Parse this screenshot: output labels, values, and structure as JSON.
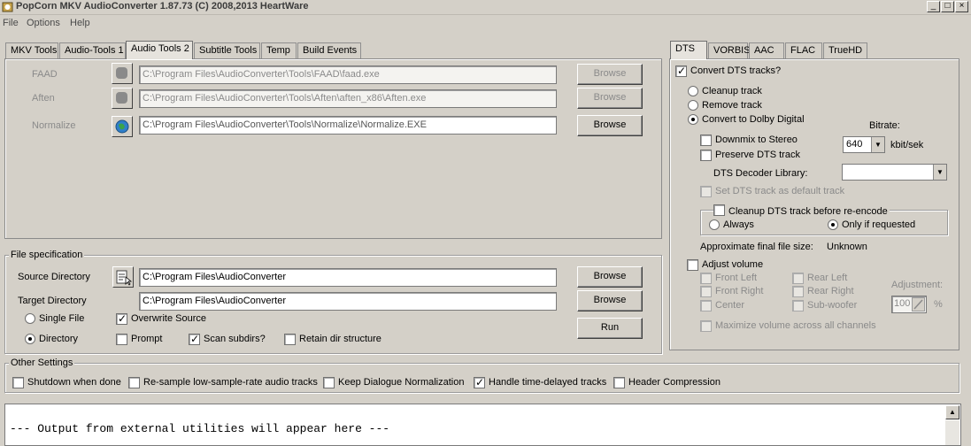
{
  "window": {
    "title": "PopCorn MKV AudioConverter 1.87.73 (C) 2008,2013 HeartWare",
    "minimize": "_",
    "maximize": "□",
    "close": "×"
  },
  "menu": [
    "File",
    "Options",
    "Help"
  ],
  "left_tabs": [
    "MKV Tools",
    "Audio-Tools 1",
    "Audio Tools 2",
    "Subtitle Tools",
    "Temp",
    "Build Events"
  ],
  "tools": [
    {
      "label": "FAAD",
      "path": "C:\\Program Files\\AudioConverter\\Tools\\FAAD\\faad.exe",
      "button": "Browse",
      "enabled": false,
      "icon": "stop-icon"
    },
    {
      "label": "Aften",
      "path": "C:\\Program Files\\AudioConverter\\Tools\\Aften\\aften_x86\\Aften.exe",
      "button": "Browse",
      "enabled": false,
      "icon": "stop-icon"
    },
    {
      "label": "Normalize",
      "path": "C:\\Program Files\\AudioConverter\\Tools\\Normalize\\Normalize.EXE",
      "button": "Browse",
      "enabled": true,
      "icon": "globe-icon"
    }
  ],
  "file_spec": {
    "title": "File specification",
    "source_label": "Source Directory",
    "source_value": "C:\\Program Files\\AudioConverter",
    "target_label": "Target Directory",
    "target_value": "C:\\Program Files\\AudioConverter",
    "browse": "Browse",
    "run": "Run",
    "single_file": "Single File",
    "directory": "Directory",
    "overwrite_source": "Overwrite Source",
    "prompt": "Prompt",
    "scan_subdirs": "Scan subdirs?",
    "retain_dir": "Retain dir structure"
  },
  "other_settings": {
    "title": "Other Settings",
    "shutdown": "Shutdown when done",
    "resample": "Re-sample low-sample-rate audio tracks",
    "keep_dialogue": "Keep Dialogue Normalization",
    "handle_delayed": "Handle time-delayed tracks",
    "header_compression": "Header Compression"
  },
  "right_tabs": [
    "DTS",
    "VORBIS",
    "AAC",
    "FLAC",
    "TrueHD"
  ],
  "dts": {
    "convert": "Convert DTS tracks?",
    "cleanup": "Cleanup track",
    "remove": "Remove track",
    "convert_dd": "Convert to Dolby Digital",
    "bitrate_label": "Bitrate:",
    "bitrate_value": "640",
    "bitrate_unit": "kbit/sek",
    "downmix": "Downmix to Stereo",
    "preserve": "Preserve DTS track",
    "decoder_label": "DTS Decoder Library:",
    "decoder_value": "",
    "set_default": "Set DTS track as default track",
    "cleanup_reencode": "Cleanup DTS track before re-encode",
    "always": "Always",
    "only_if": "Only if requested",
    "final_size_label": "Approximate final file size:",
    "final_size_value": "Unknown",
    "adjust_volume": "Adjust volume",
    "front_left": "Front Left",
    "front_right": "Front Right",
    "center": "Center",
    "rear_left": "Rear Left",
    "rear_right": "Rear Right",
    "subwoofer": "Sub-woofer",
    "adjustment_label": "Adjustment:",
    "adjustment_value": "100",
    "percent": "%",
    "maximize": "Maximize volume across all channels"
  },
  "output": {
    "text": "--- Output from external utilities will appear here ---",
    "scroll_up": "▲"
  }
}
